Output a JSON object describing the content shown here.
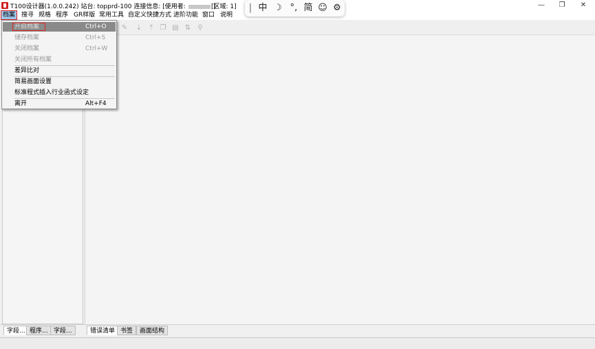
{
  "titlebar": {
    "title": "T100设计器(1.0.0.242) 站台: topprd-100 连接信息: [使用者:",
    "title_end": "]",
    "region": "[区域: 1]",
    "minimize": "—",
    "restore": "❐",
    "close": "✕"
  },
  "menubar": {
    "items": [
      {
        "label": "档案"
      },
      {
        "label": "搜寻"
      },
      {
        "label": "规格"
      },
      {
        "label": "程序"
      },
      {
        "label": "GR样版"
      },
      {
        "label": "常用工具"
      },
      {
        "label": "自定义快捷方式"
      },
      {
        "label": "进阶功能"
      },
      {
        "label": "窗口"
      },
      {
        "label": "说明"
      }
    ]
  },
  "file_menu": {
    "items": [
      {
        "label": "开启档案",
        "shortcut": "Ctrl+O"
      },
      {
        "label": "储存档案",
        "shortcut": "Ctrl+S"
      },
      {
        "label": "关闭档案",
        "shortcut": "Ctrl+W"
      },
      {
        "label": "关闭所有档案",
        "shortcut": ""
      },
      {
        "label": "差异比对",
        "shortcut": ""
      },
      {
        "label": "简易画面设置",
        "shortcut": ""
      },
      {
        "label": "标准程式插入行业函式设定",
        "shortcut": ""
      },
      {
        "label": "离开",
        "shortcut": "Alt+F4"
      }
    ]
  },
  "ime_toolbar": {
    "cursor": "|",
    "mode": "中",
    "moon_icon": "☽",
    "punct": "°,",
    "script": "简",
    "emoji_icon": "☺",
    "settings_icon": "⚙"
  },
  "left_tabs": [
    "字段...",
    "程序...",
    "字段..."
  ],
  "bottom_tabs": [
    "错误清单",
    "书签",
    "画面结构"
  ],
  "colors": {
    "menu_highlight": "#8a8a8a",
    "annotation_red": "#e02020"
  }
}
